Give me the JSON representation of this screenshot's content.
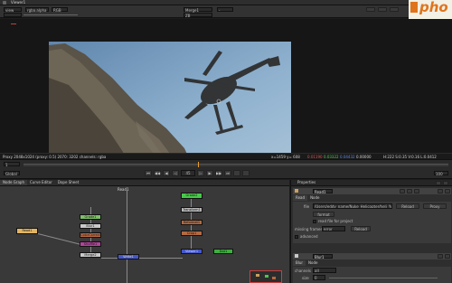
{
  "window": {
    "title": "Viewer1"
  },
  "logo": {
    "text": "pho",
    "accent": "#e0741c",
    "bg": "#f3f0e6"
  },
  "viewer_toolbar": {
    "left_fields": [
      "view",
      "rgba.alpha",
      "RGB"
    ],
    "center_fields": [
      "Merge1",
      "-",
      "ZB"
    ]
  },
  "viewer_status": {
    "format": "Proxy 2048x1024 (proxy: 0.5) 2070: 3202 channels: rgba",
    "coords": "x=1459  y= 608",
    "rgb_red": "0.01190",
    "rgb_green": "0.03322",
    "rgb_blue": "0.04432",
    "rgb_alpha": "0.00000",
    "hsv": "H:222 S:0.35 V:0.16 L:0.0412"
  },
  "playback": {
    "frame": "45",
    "start": "1",
    "end": "100",
    "fps": "Global"
  },
  "panel_tabs": [
    "Node Graph",
    "Curve Editor",
    "Dope Sheet"
  ],
  "properties": {
    "title": "Properties",
    "node_name": "Read1",
    "tabs": [
      "Read",
      "Node"
    ],
    "file_label": "file",
    "file_path": "/Users/eddy_name/Nuke_Helicopter/heli_%04d.dpx",
    "file_btn_cancel": "Reload",
    "file_btn_proxy": "Proxy",
    "format_btn": "format",
    "read_all": "read file for project",
    "missing_label": "missing frames",
    "missing_value": "error",
    "reload_btn": "Reload",
    "advanced_label": "advanced",
    "second_node": "Blur1",
    "second_tabs": [
      "Blur",
      "Node"
    ],
    "channels_label": "channels",
    "channels_value": "all",
    "size_label": "size",
    "size_value": "0"
  },
  "nodegraph": {
    "top_label": "Read1",
    "nodes": [
      {
        "label": "Read1",
        "color": "#e1b464"
      },
      {
        "label": "Grade1",
        "color": "#7fbf6a"
      },
      {
        "label": "Blur1",
        "color": "#c9c9c9"
      },
      {
        "label": "ColorCorrect1",
        "color": "#b96b46"
      },
      {
        "label": "Shuffle1",
        "color": "#b2439a"
      },
      {
        "label": "Merge2",
        "color": "#c9c9c9"
      },
      {
        "label": "Write1",
        "color": "#4557c9"
      },
      {
        "label": "Grade2",
        "color": "#4ac84a"
      },
      {
        "label": "Transform1",
        "color": "#b8b8b8"
      },
      {
        "label": "Reformat1",
        "color": "#b36a42"
      },
      {
        "label": "Crop1",
        "color": "#b36a42"
      },
      {
        "label": "Viewer1",
        "color": "#4557c9"
      },
      {
        "label": "Dot1",
        "color": "#3fae3f"
      }
    ]
  }
}
